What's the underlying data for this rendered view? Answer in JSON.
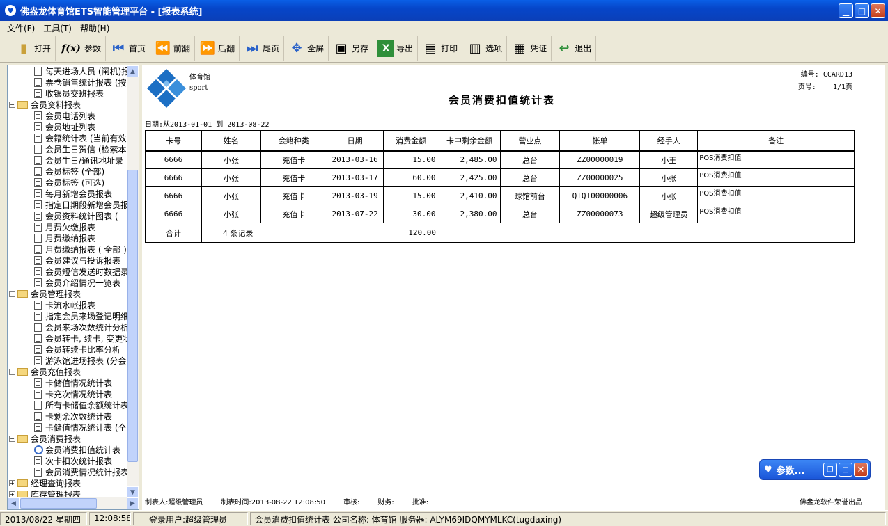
{
  "window": {
    "title": "佛盎龙体育馆ETS智能管理平台 - [报表系统]",
    "icon": "app-icon"
  },
  "menu": [
    "文件(F)",
    "工具(T)",
    "帮助(H)"
  ],
  "toolbar": [
    {
      "label": "打开",
      "icon": "open-book-icon",
      "glyph": "▮"
    },
    {
      "label": "参数",
      "icon": "function-icon",
      "glyph": "f(x)"
    },
    {
      "label": "首页",
      "icon": "first-page-icon",
      "glyph": "⏮"
    },
    {
      "label": "前翻",
      "icon": "previous-page-icon",
      "glyph": "⏪"
    },
    {
      "label": "后翻",
      "icon": "next-page-icon",
      "glyph": "⏩"
    },
    {
      "label": "尾页",
      "icon": "last-page-icon",
      "glyph": "⏭"
    },
    {
      "label": "全屏",
      "icon": "fullscreen-icon",
      "glyph": "✥"
    },
    {
      "label": "另存",
      "icon": "save-as-icon",
      "glyph": "▣"
    },
    {
      "label": "导出",
      "icon": "excel-export-icon",
      "glyph": "X"
    },
    {
      "label": "打印",
      "icon": "printer-icon",
      "glyph": "▤"
    },
    {
      "label": "选项",
      "icon": "options-icon",
      "glyph": "▥"
    },
    {
      "label": "凭证",
      "icon": "voucher-icon",
      "glyph": "▦"
    },
    {
      "label": "退出",
      "icon": "exit-icon",
      "glyph": "↩"
    }
  ],
  "tree": [
    {
      "level": 2,
      "type": "doc",
      "label": "每天进场人员 (闸机)报"
    },
    {
      "level": 2,
      "type": "doc",
      "label": "票卷销售统计报表 (按"
    },
    {
      "level": 2,
      "type": "doc",
      "label": "收银员交班报表"
    },
    {
      "level": 1,
      "type": "folder",
      "exp": "−",
      "label": "会员资料报表"
    },
    {
      "level": 2,
      "type": "doc",
      "label": "会员电话列表"
    },
    {
      "level": 2,
      "type": "doc",
      "label": "会员地址列表"
    },
    {
      "level": 2,
      "type": "doc",
      "label": "会籍统计表 (当前有效"
    },
    {
      "level": 2,
      "type": "doc",
      "label": "会员生日贺信 (检索本"
    },
    {
      "level": 2,
      "type": "doc",
      "label": "会员生日/通讯地址录"
    },
    {
      "level": 2,
      "type": "doc",
      "label": "会员标签 (全部)"
    },
    {
      "level": 2,
      "type": "doc",
      "label": "会员标签 (可选)"
    },
    {
      "level": 2,
      "type": "doc",
      "label": "每月新增会员报表"
    },
    {
      "level": 2,
      "type": "doc",
      "label": "指定日期段新增会员报"
    },
    {
      "level": 2,
      "type": "doc",
      "label": "会员资料统计图表 (一"
    },
    {
      "level": 2,
      "type": "doc",
      "label": "月费欠缴报表"
    },
    {
      "level": 2,
      "type": "doc",
      "label": "月费缴纳报表"
    },
    {
      "level": 2,
      "type": "doc",
      "label": "月费缴纳报表 ( 全部 )"
    },
    {
      "level": 2,
      "type": "doc",
      "label": "会员建议与投诉报表"
    },
    {
      "level": 2,
      "type": "doc",
      "label": "会员短信发送时数据录"
    },
    {
      "level": 2,
      "type": "doc",
      "label": "会员介绍情况一览表"
    },
    {
      "level": 1,
      "type": "folder",
      "exp": "−",
      "label": "会员管理报表"
    },
    {
      "level": 2,
      "type": "doc",
      "label": "卡流水帐报表"
    },
    {
      "level": 2,
      "type": "doc",
      "label": "指定会员来场登记明细"
    },
    {
      "level": 2,
      "type": "doc",
      "label": "会员来场次数统计分析"
    },
    {
      "level": 2,
      "type": "doc",
      "label": "会员转卡, 续卡, 变更状"
    },
    {
      "level": 2,
      "type": "doc",
      "label": "会员转续卡比率分析"
    },
    {
      "level": 2,
      "type": "doc",
      "label": "游泳馆进场报表 (分会"
    },
    {
      "level": 1,
      "type": "folder",
      "exp": "−",
      "label": "会员充值报表"
    },
    {
      "level": 2,
      "type": "doc",
      "label": "卡储值情况统计表"
    },
    {
      "level": 2,
      "type": "doc",
      "label": "卡充次情况统计表"
    },
    {
      "level": 2,
      "type": "doc",
      "label": "所有卡储值余额统计表"
    },
    {
      "level": 2,
      "type": "doc",
      "label": "卡剩余次数统计表"
    },
    {
      "level": 2,
      "type": "doc",
      "label": "卡储值情况统计表 (全部"
    },
    {
      "level": 1,
      "type": "folder",
      "exp": "−",
      "label": "会员消费报表"
    },
    {
      "level": 2,
      "type": "mag",
      "label": "会员消费扣值统计表"
    },
    {
      "level": 2,
      "type": "doc",
      "label": "次卡扣次统计报表"
    },
    {
      "level": 2,
      "type": "doc",
      "label": "会员消费情况统计报表"
    },
    {
      "level": 1,
      "type": "folder",
      "exp": "+",
      "label": "经理查询报表"
    },
    {
      "level": 1,
      "type": "folder",
      "exp": "+",
      "label": "库存管理报表"
    }
  ],
  "report": {
    "logo_text1": "体育馆",
    "logo_text2": "sport",
    "title": "会员消费扣值统计表",
    "code_label": "编号:",
    "code_value": "CCARD13",
    "page_label": "页号:",
    "page_value": "1/1页",
    "date_range": "日期:从2013-01-01 到 2013-08-22",
    "columns": [
      "卡号",
      "姓名",
      "会籍种类",
      "日期",
      "消费金额",
      "卡中剩余金额",
      "营业点",
      "帐单",
      "经手人",
      "备注"
    ],
    "rows": [
      [
        "6666",
        "小张",
        "充值卡",
        "2013-03-16",
        "15.00",
        "2,485.00",
        "总台",
        "ZZ00000019",
        "小王",
        "POS消费扣值"
      ],
      [
        "6666",
        "小张",
        "充值卡",
        "2013-03-17",
        "60.00",
        "2,425.00",
        "总台",
        "ZZ00000025",
        "小张",
        "POS消费扣值"
      ],
      [
        "6666",
        "小张",
        "充值卡",
        "2013-03-19",
        "15.00",
        "2,410.00",
        "球馆前台",
        "QTQT00000006",
        "小张",
        "POS消费扣值"
      ],
      [
        "6666",
        "小张",
        "充值卡",
        "2013-07-22",
        "30.00",
        "2,380.00",
        "总台",
        "ZZ00000073",
        "超级管理员",
        "POS消费扣值"
      ]
    ],
    "total_label": "合计",
    "total_records": "4 条记录",
    "total_amount": "120.00",
    "footer": {
      "maker": "制表人:超级管理员",
      "time": "制表时间:2013-08-22 12:08:50",
      "audit": "审核:",
      "finance": "财务:",
      "approve": "批准:",
      "vendor": "佛盎龙软件荣誉出品"
    }
  },
  "popup": {
    "title": "参数..."
  },
  "status": {
    "date": "2013/08/22 星期四",
    "time": "12:08:58",
    "user": "登录用户:超级管理员",
    "info": "会员消费扣值统计表 公司名称: 体育馆 服务器: ALYM69IDQMYMLKC(tugdaxing)"
  },
  "colors": {
    "title_blue": "#0646c9",
    "chrome": "#ece9d8",
    "scroll": "#c1d3fb"
  }
}
